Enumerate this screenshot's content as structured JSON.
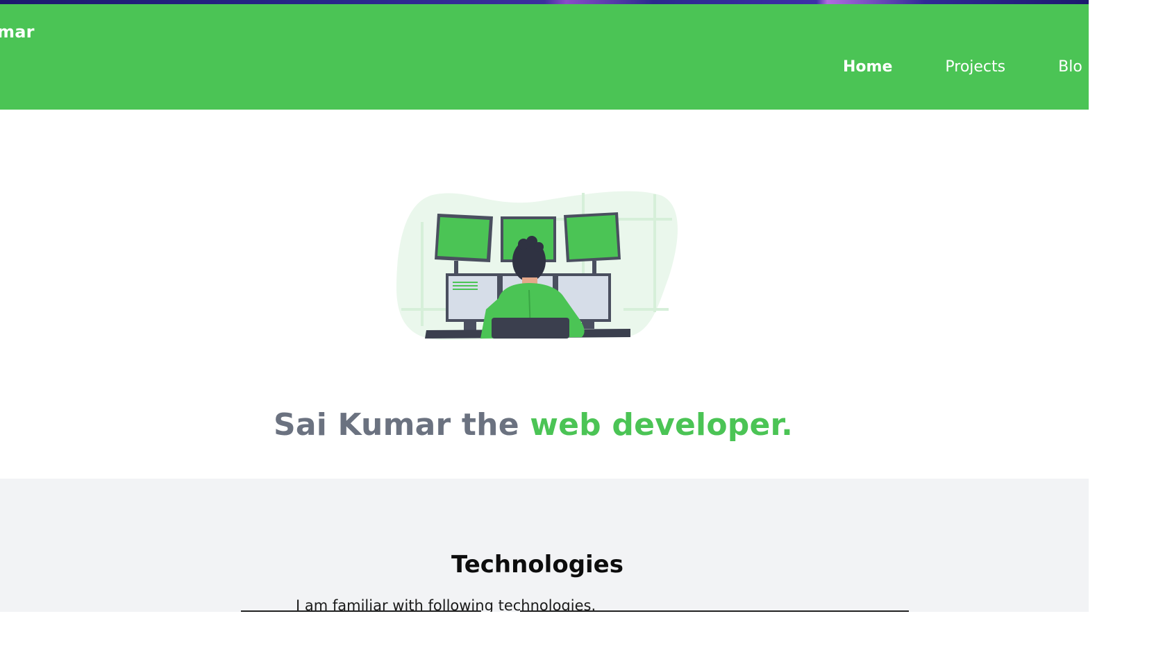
{
  "brand": {
    "name": "mar"
  },
  "nav": {
    "items": [
      {
        "label": "Home",
        "active": true
      },
      {
        "label": "Projects",
        "active": false
      },
      {
        "label": "Blo",
        "active": false
      }
    ]
  },
  "hero": {
    "title_part1": "Sai Kumar the ",
    "title_part2": "web developer."
  },
  "technologies": {
    "heading": "Technologies",
    "subtitle": "I am familiar with following technologies."
  },
  "colors": {
    "brand_green": "#4bc455",
    "title_gray": "#6b7280",
    "section_bg": "#f2f3f5"
  },
  "icons": [
    "developer-illustration"
  ]
}
